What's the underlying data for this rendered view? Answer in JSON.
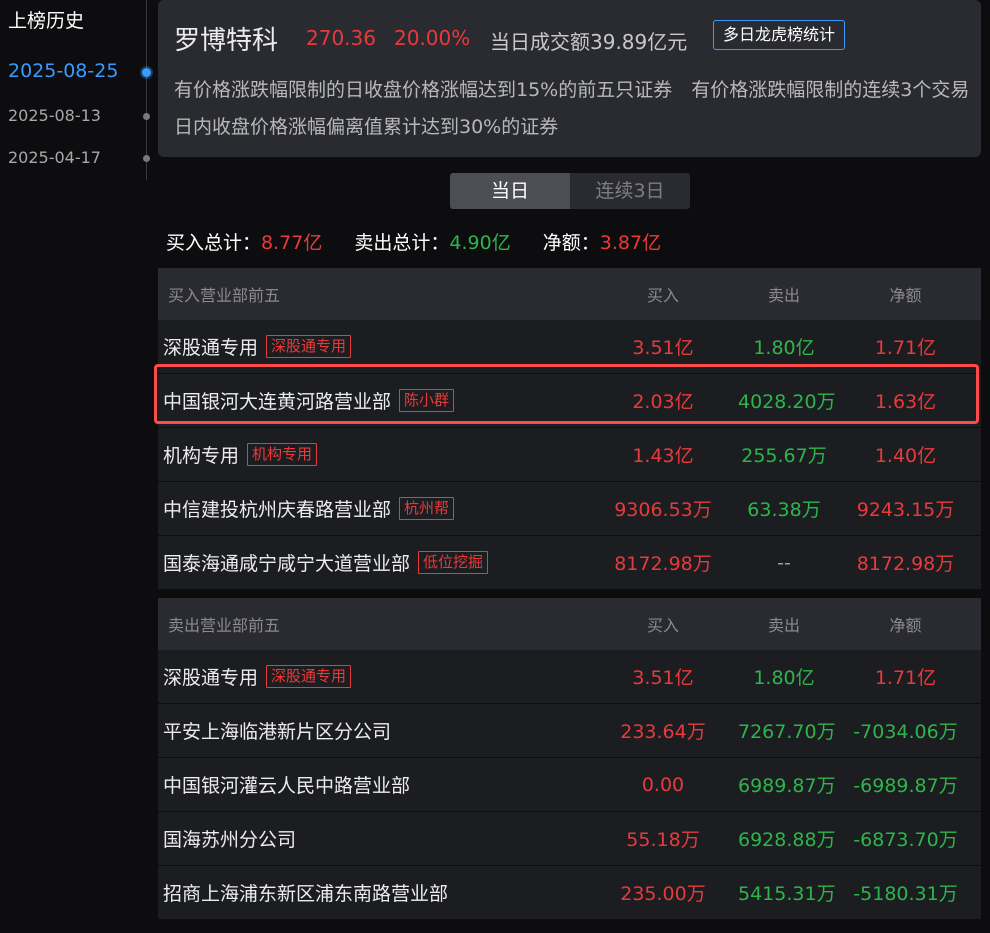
{
  "history": {
    "title": "上榜历史",
    "dates": [
      "2025-08-25",
      "2025-08-13",
      "2025-04-17"
    ]
  },
  "stock": {
    "name": "罗博特科",
    "price": "270.36",
    "change_pct": "20.00%",
    "turnover": "当日成交额39.89亿元",
    "multi_day_button": "多日龙虎榜统计",
    "reason": "有价格涨跌幅限制的日收盘价格涨幅达到15%的前五只证券　有价格涨跌幅限制的连续3个交易日内收盘价格涨幅偏离值累计达到30%的证券"
  },
  "tabs": [
    {
      "label": "当日"
    },
    {
      "label": "连续3日"
    }
  ],
  "totals": {
    "buy_label": "买入总计：",
    "buy_value": "8.77亿",
    "sell_label": "卖出总计：",
    "sell_value": "4.90亿",
    "net_label": "净额：",
    "net_value": "3.87亿"
  },
  "buy_table": {
    "title": "买入营业部前五",
    "headers": {
      "buy": "买入",
      "sell": "卖出",
      "net": "净额"
    },
    "rows": [
      {
        "name": "深股通专用",
        "tag": "深股通专用",
        "buy": "3.51亿",
        "sell": "1.80亿",
        "net": "1.71亿"
      },
      {
        "name": "中国银河大连黄河路营业部",
        "tag": "陈小群",
        "buy": "2.03亿",
        "sell": "4028.20万",
        "net": "1.63亿"
      },
      {
        "name": "机构专用",
        "tag": "机构专用",
        "buy": "1.43亿",
        "sell": "255.67万",
        "net": "1.40亿"
      },
      {
        "name": "中信建投杭州庆春路营业部",
        "tag": "杭州帮",
        "buy": "9306.53万",
        "sell": "63.38万",
        "net": "9243.15万"
      },
      {
        "name": "国泰海通咸宁咸宁大道营业部",
        "tag": "低位挖掘",
        "buy": "8172.98万",
        "sell": "--",
        "net": "8172.98万"
      }
    ]
  },
  "sell_table": {
    "title": "卖出营业部前五",
    "headers": {
      "buy": "买入",
      "sell": "卖出",
      "net": "净额"
    },
    "rows": [
      {
        "name": "深股通专用",
        "tag": "深股通专用",
        "buy": "3.51亿",
        "sell": "1.80亿",
        "net": "1.71亿"
      },
      {
        "name": "平安上海临港新片区分公司",
        "tag": "",
        "buy": "233.64万",
        "sell": "7267.70万",
        "net": "-7034.06万"
      },
      {
        "name": "中国银河灌云人民中路营业部",
        "tag": "",
        "buy": "0.00",
        "sell": "6989.87万",
        "net": "-6989.87万"
      },
      {
        "name": "国海苏州分公司",
        "tag": "",
        "buy": "55.18万",
        "sell": "6928.88万",
        "net": "-6873.70万"
      },
      {
        "name": "招商上海浦东新区浦东南路营业部",
        "tag": "",
        "buy": "235.00万",
        "sell": "5415.31万",
        "net": "-5180.31万"
      }
    ]
  },
  "colors": {
    "up": "#e83a3a",
    "down": "#2bb64a",
    "accent": "#3a9bff",
    "highlight": "#ff4a4a"
  }
}
